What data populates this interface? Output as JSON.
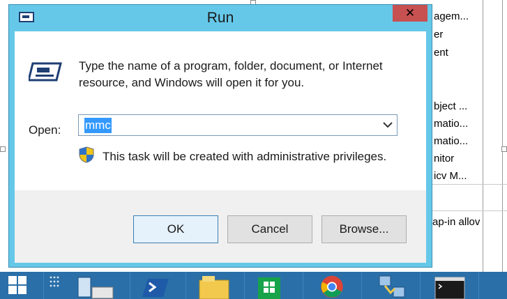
{
  "background_window": {
    "items": [
      "agem...",
      "er",
      "ent",
      "bject ...",
      "matio...",
      "matio...",
      "nitor",
      "icv M...",
      "ap-in allov"
    ]
  },
  "dialog": {
    "title": "Run",
    "close_glyph": "✕",
    "description": "Type the name of a program, folder, document, or Internet resource, and Windows will open it for you.",
    "open_label": "Open:",
    "open_value": "mmc",
    "admin_note": "This task will be created with administrative privileges.",
    "buttons": {
      "ok": "OK",
      "cancel": "Cancel",
      "browse": "Browse..."
    }
  },
  "taskbar": {
    "items": [
      "start-icon",
      "server-manager-icon",
      "powershell-icon",
      "file-explorer-icon",
      "store-icon",
      "chrome-icon",
      "network-icon",
      "command-prompt-icon"
    ]
  },
  "colors": {
    "title_bar": "#66c8e8",
    "close_button": "#c75050",
    "taskbar": "#2a6fa8",
    "selection": "#3399ff"
  }
}
